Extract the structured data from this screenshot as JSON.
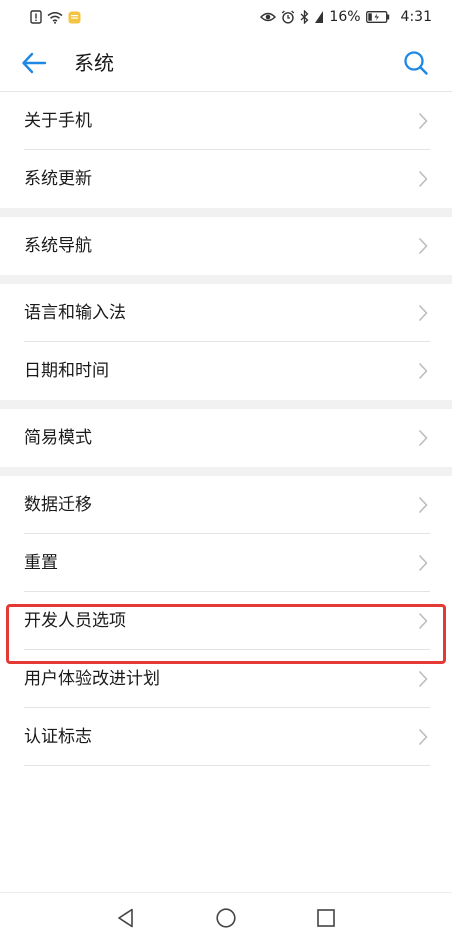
{
  "status_bar": {
    "battery_percent": "16%",
    "time": "4:31"
  },
  "header": {
    "title": "系统",
    "back_icon": "arrow-left-icon",
    "search_icon": "search-icon",
    "accent_color": "#1e88e5"
  },
  "groups": [
    {
      "items": [
        {
          "label": "关于手机"
        },
        {
          "label": "系统更新"
        }
      ]
    },
    {
      "items": [
        {
          "label": "系统导航"
        }
      ]
    },
    {
      "items": [
        {
          "label": "语言和输入法"
        },
        {
          "label": "日期和时间"
        }
      ]
    },
    {
      "items": [
        {
          "label": "简易模式"
        }
      ]
    },
    {
      "items": [
        {
          "label": "数据迁移"
        },
        {
          "label": "重置"
        },
        {
          "label": "开发人员选项"
        },
        {
          "label": "用户体验改进计划"
        },
        {
          "label": "认证标志"
        }
      ]
    }
  ],
  "highlight": {
    "target": "开发人员选项",
    "color": "#e53935"
  },
  "nav_bar": {
    "icons": [
      "nav-back-icon",
      "nav-home-icon",
      "nav-recent-icon"
    ]
  }
}
